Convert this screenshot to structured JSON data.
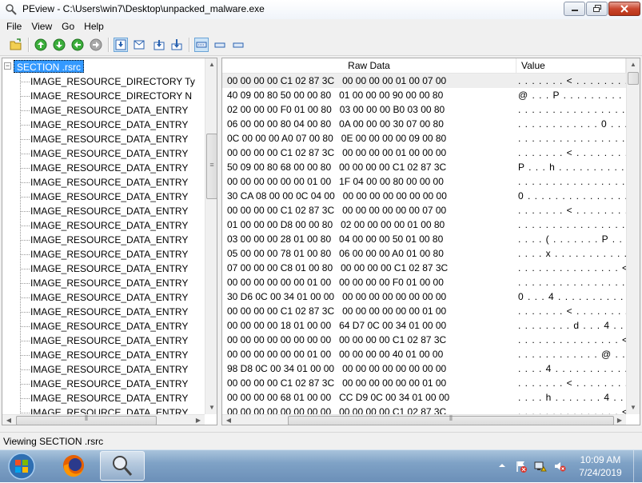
{
  "window": {
    "title": "PEview - C:\\Users\\win7\\Desktop\\unpacked_malware.exe"
  },
  "menu": [
    "File",
    "View",
    "Go",
    "Help"
  ],
  "tree": {
    "root_label": "SECTION .rsrc",
    "items": [
      "IMAGE_RESOURCE_DIRECTORY Ty",
      "IMAGE_RESOURCE_DIRECTORY N",
      "IMAGE_RESOURCE_DATA_ENTRY",
      "IMAGE_RESOURCE_DATA_ENTRY",
      "IMAGE_RESOURCE_DATA_ENTRY",
      "IMAGE_RESOURCE_DATA_ENTRY",
      "IMAGE_RESOURCE_DATA_ENTRY",
      "IMAGE_RESOURCE_DATA_ENTRY",
      "IMAGE_RESOURCE_DATA_ENTRY",
      "IMAGE_RESOURCE_DATA_ENTRY",
      "IMAGE_RESOURCE_DATA_ENTRY",
      "IMAGE_RESOURCE_DATA_ENTRY",
      "IMAGE_RESOURCE_DATA_ENTRY",
      "IMAGE_RESOURCE_DATA_ENTRY",
      "IMAGE_RESOURCE_DATA_ENTRY",
      "IMAGE_RESOURCE_DATA_ENTRY",
      "IMAGE_RESOURCE_DATA_ENTRY",
      "IMAGE_RESOURCE_DATA_ENTRY",
      "IMAGE_RESOURCE_DATA_ENTRY",
      "IMAGE_RESOURCE_DATA_ENTRY",
      "IMAGE_RESOURCE_DATA_ENTRY",
      "IMAGE_RESOURCE_DATA_ENTRY",
      "IMAGE_RESOURCE_DATA_ENTRY",
      "IMAGE_RESOURCE_DATA_ENTRY"
    ]
  },
  "hex": {
    "headers": {
      "raw": "Raw Data",
      "value": "Value"
    },
    "rows": [
      {
        "bytes": "00 00 00 00 C1 02 87 3C   00 00 00 00 01 00 07 00",
        "value": ". . . . . . . < . . . . . . . ."
      },
      {
        "bytes": "40 09 00 80 50 00 00 80   01 00 00 00 90 00 00 80",
        "value": "@ . . . P . . . . . . . . . . ."
      },
      {
        "bytes": "02 00 00 00 F0 01 00 80   03 00 00 00 B0 03 00 80",
        "value": ". . . . . . . . . . . . . . . ."
      },
      {
        "bytes": "06 00 00 00 80 04 00 80   0A 00 00 00 30 07 00 80",
        "value": ". . . . . . . . . . . . 0 . . ."
      },
      {
        "bytes": "0C 00 00 00 A0 07 00 80   0E 00 00 00 00 09 00 80",
        "value": ". . . . . . . . . . . . . . . ."
      },
      {
        "bytes": "00 00 00 00 C1 02 87 3C   00 00 00 00 01 00 00 00",
        "value": ". . . . . . . < . . . . . . . ."
      },
      {
        "bytes": "50 09 00 80 68 00 00 80   00 00 00 00 C1 02 87 3C",
        "value": "P . . . h . . . . . . . . . . <"
      },
      {
        "bytes": "00 00 00 00 00 00 01 00   1F 04 00 00 80 00 00 00",
        "value": ". . . . . . . . . . . . . . . ."
      },
      {
        "bytes": "30 CA 08 00 00 0C 04 00   00 00 00 00 00 00 00 00",
        "value": "0 . . . . . . . . . . . . . . ."
      },
      {
        "bytes": "00 00 00 00 C1 02 87 3C   00 00 00 00 00 00 07 00",
        "value": ". . . . . . . < . . . . . . . ."
      },
      {
        "bytes": "01 00 00 00 D8 00 00 80   02 00 00 00 00 01 00 80",
        "value": ". . . . . . . . . . . . . . . ."
      },
      {
        "bytes": "03 00 00 00 28 01 00 80   04 00 00 00 50 01 00 80",
        "value": ". . . . ( . . . . . . . P . . ."
      },
      {
        "bytes": "05 00 00 00 78 01 00 80   06 00 00 00 A0 01 00 80",
        "value": ". . . . x . . . . . . . . . . ."
      },
      {
        "bytes": "07 00 00 00 C8 01 00 80   00 00 00 00 C1 02 87 3C",
        "value": ". . . . . . . . . . . . . . . <"
      },
      {
        "bytes": "00 00 00 00 00 00 01 00   00 00 00 00 F0 01 00 00",
        "value": ". . . . . . . . . . . . . . . ."
      },
      {
        "bytes": "30 D6 0C 00 34 01 00 00   00 00 00 00 00 00 00 00",
        "value": "0 . . . 4 . . . . . . . . . . ."
      },
      {
        "bytes": "00 00 00 00 C1 02 87 3C   00 00 00 00 00 00 01 00",
        "value": ". . . . . . . < . . . . . . . ."
      },
      {
        "bytes": "00 00 00 00 18 01 00 00   64 D7 0C 00 34 01 00 00",
        "value": ". . . . . . . . d . . . 4 . . ."
      },
      {
        "bytes": "00 00 00 00 00 00 00 00   00 00 00 00 C1 02 87 3C",
        "value": ". . . . . . . . . . . . . . . <"
      },
      {
        "bytes": "00 00 00 00 00 00 01 00   00 00 00 00 40 01 00 00",
        "value": ". . . . . . . . . . . . @ . . ."
      },
      {
        "bytes": "98 D8 0C 00 34 01 00 00   00 00 00 00 00 00 00 00",
        "value": ". . . . 4 . . . . . . . . . . ."
      },
      {
        "bytes": "00 00 00 00 C1 02 87 3C   00 00 00 00 00 00 01 00",
        "value": ". . . . . . . < . . . . . . . ."
      },
      {
        "bytes": "00 00 00 00 68 01 00 00   CC D9 0C 00 34 01 00 00",
        "value": ". . . . h . . . . . . . 4 . . ."
      },
      {
        "bytes": "00 00 00 00 00 00 00 00   00 00 00 00 C1 02 87 3C",
        "value": ". . . . . . . . . . . . . . . <"
      }
    ]
  },
  "status": {
    "text": "Viewing SECTION .rsrc"
  },
  "taskbar": {
    "clock_time": "10:09 AM",
    "clock_date": "7/24/2019"
  },
  "icons": {
    "app": "peview-app-icon",
    "toolbar": [
      "open-file-icon",
      "go-top-icon",
      "go-down-icon",
      "go-back-icon",
      "go-forward-icon",
      "view-byte-icon",
      "view-mail-icon",
      "view-dword-icon",
      "view-qword-icon",
      "list-view-icon",
      "single-line-icon",
      "double-line-icon"
    ]
  },
  "colors": {
    "selection": "#3399ff",
    "taskbar": "#7fa2c6",
    "close_button": "#c9462e"
  }
}
